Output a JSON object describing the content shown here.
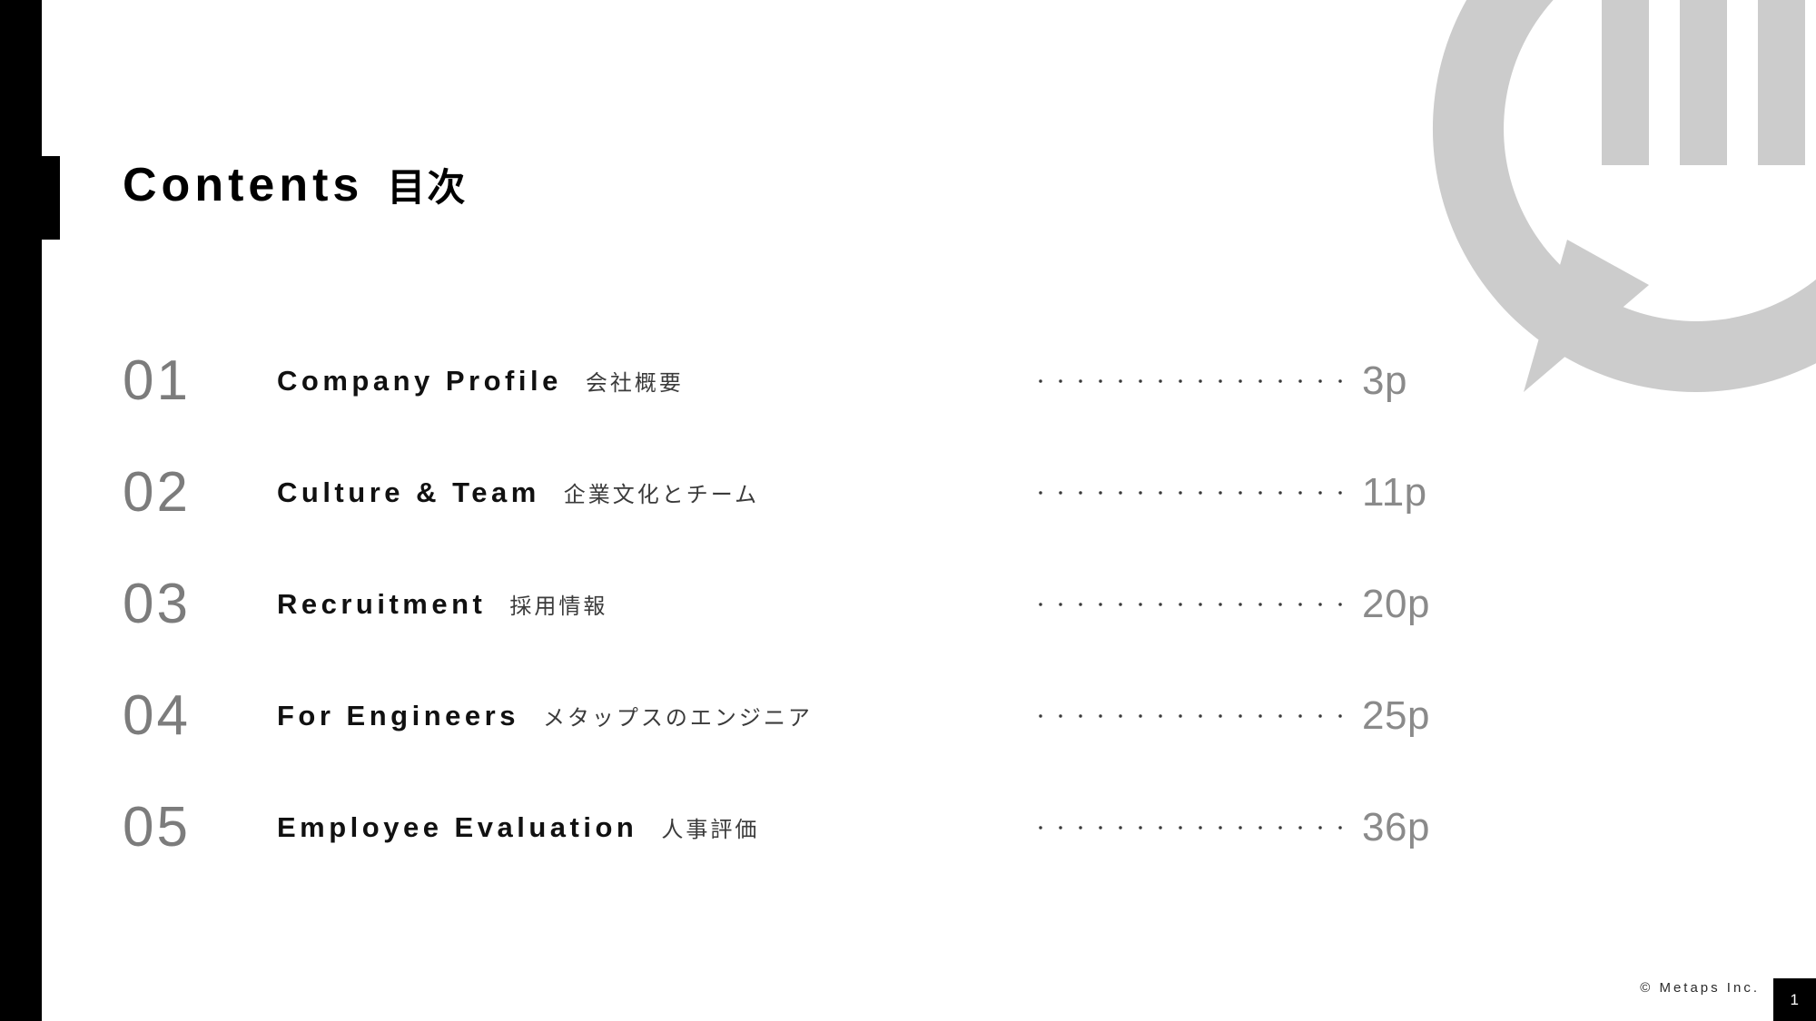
{
  "slide": {
    "background_color": "#ffffff",
    "accent_color": "#000000",
    "watermark_color": "#cccccc",
    "number_color": "#7c7c7c",
    "page_number_color": "#8a8a8a"
  },
  "title": {
    "main": "Contents",
    "japanese": "目次"
  },
  "contents": [
    {
      "number": "01",
      "english": "Company Profile",
      "japanese": "会社概要",
      "page": "3p"
    },
    {
      "number": "02",
      "english": "Culture & Team",
      "japanese": "企業文化とチーム",
      "page": "11p"
    },
    {
      "number": "03",
      "english": "Recruitment",
      "japanese": "採用情報",
      "page": "20p"
    },
    {
      "number": "04",
      "english": "For Engineers",
      "japanese": "メタップスのエンジニア",
      "page": "25p"
    },
    {
      "number": "05",
      "english": "Employee Evaluation",
      "japanese": "人事評価",
      "page": "36p"
    }
  ],
  "footer": {
    "copyright": "© Metaps Inc.",
    "page_number": "1"
  },
  "logo": {
    "name": "metaps-speech-bubble-logo"
  }
}
